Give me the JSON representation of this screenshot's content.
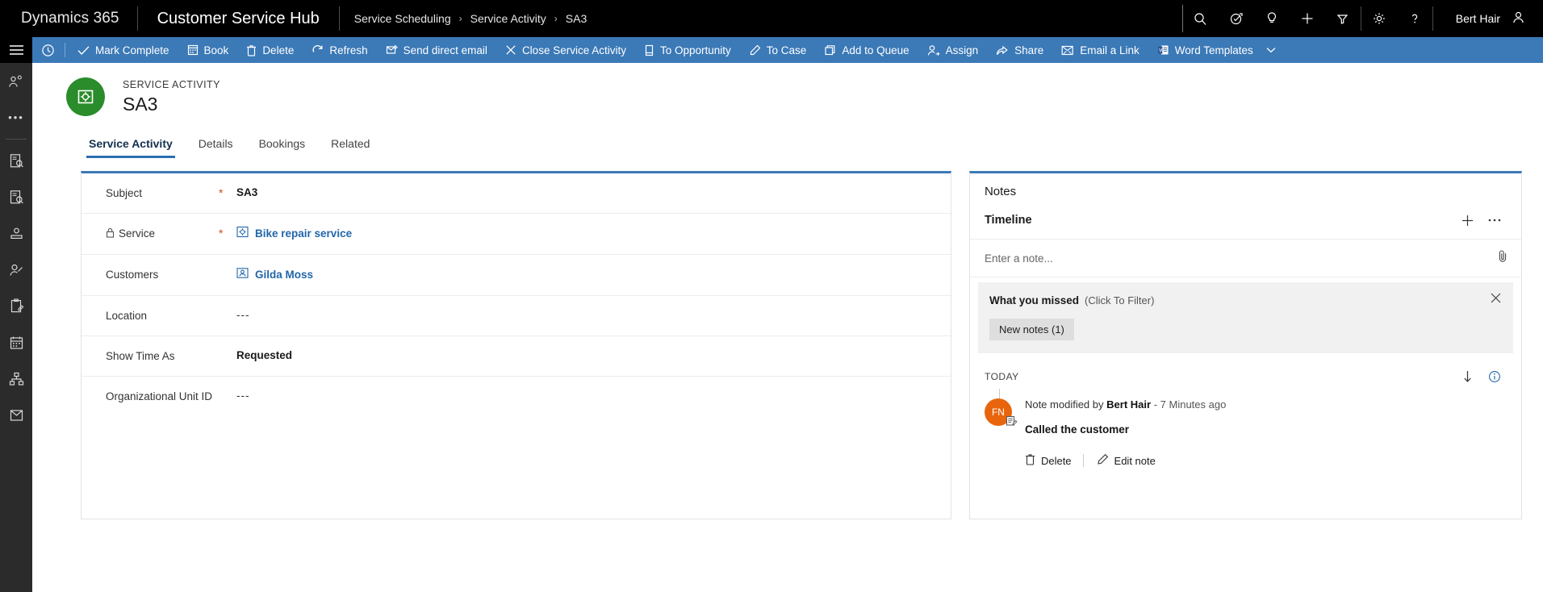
{
  "topnav": {
    "brand": "Dynamics 365",
    "app_title": "Customer Service Hub",
    "breadcrumb": [
      "Service Scheduling",
      "Service Activity",
      "SA3"
    ],
    "chevron": "›",
    "icons": [
      {
        "name": "search-icon",
        "label": "Search"
      },
      {
        "name": "assistant-icon",
        "label": "Assistant"
      },
      {
        "name": "lightbulb-icon",
        "label": "Insights"
      },
      {
        "name": "add-icon",
        "label": "Quick Create"
      },
      {
        "name": "filter-icon",
        "label": "Filter"
      },
      {
        "name": "gear-icon",
        "label": "Settings"
      },
      {
        "name": "help-icon",
        "label": "Help"
      }
    ],
    "user_name": "Bert Hair"
  },
  "rail": {
    "items": [
      {
        "name": "site-map-icon",
        "label": "Site Map"
      },
      {
        "name": "recent-contacts-icon",
        "label": "Recent"
      },
      {
        "name": "more-icon",
        "label": "More"
      },
      {
        "name": "case-icon",
        "label": "Cases"
      },
      {
        "name": "document-search-icon",
        "label": "Knowledge Articles"
      },
      {
        "name": "account-icon",
        "label": "Accounts"
      },
      {
        "name": "contact-icon",
        "label": "Contacts"
      },
      {
        "name": "activity-icon",
        "label": "Activities"
      },
      {
        "name": "calendar-icon",
        "label": "Service Calendar"
      },
      {
        "name": "hierarchy-icon",
        "label": "Hierarchy"
      },
      {
        "name": "queue-icon",
        "label": "Queues"
      }
    ]
  },
  "commandbar": {
    "buttons": [
      {
        "icon": "clock-icon",
        "label": ""
      },
      {
        "icon": "check-icon",
        "label": "Mark Complete"
      },
      {
        "icon": "book-icon",
        "label": "Book"
      },
      {
        "icon": "trash-icon",
        "label": "Delete"
      },
      {
        "icon": "refresh-icon",
        "label": "Refresh"
      },
      {
        "icon": "email-send-icon",
        "label": "Send direct email"
      },
      {
        "icon": "close-icon",
        "label": "Close Service Activity"
      },
      {
        "icon": "opportunity-icon",
        "label": "To Opportunity"
      },
      {
        "icon": "case-convert-icon",
        "label": "To Case"
      },
      {
        "icon": "queue-add-icon",
        "label": "Add to Queue"
      },
      {
        "icon": "assign-icon",
        "label": "Assign"
      },
      {
        "icon": "share-icon",
        "label": "Share"
      },
      {
        "icon": "email-link-icon",
        "label": "Email a Link"
      },
      {
        "icon": "word-icon",
        "label": "Word Templates"
      },
      {
        "icon": "chevron-down-icon",
        "label": ""
      }
    ]
  },
  "record": {
    "kicker": "SERVICE ACTIVITY",
    "title": "SA3",
    "avatar_icon": "service-activity-icon",
    "avatar_color": "#2a8c2a"
  },
  "tabs": [
    {
      "label": "Service Activity",
      "active": true
    },
    {
      "label": "Details",
      "active": false
    },
    {
      "label": "Bookings",
      "active": false
    },
    {
      "label": "Related",
      "active": false
    }
  ],
  "form": {
    "rows": [
      {
        "label": "Subject",
        "required": "*",
        "locked": false,
        "value": "SA3",
        "style": "bold",
        "icon": ""
      },
      {
        "label": "Service",
        "required": "*",
        "locked": true,
        "value": "Bike repair service",
        "style": "link",
        "icon": "service-record-icon"
      },
      {
        "label": "Customers",
        "required": "",
        "locked": false,
        "value": "Gilda Moss",
        "style": "link",
        "icon": "contact-record-icon"
      },
      {
        "label": "Location",
        "required": "",
        "locked": false,
        "value": "---",
        "style": "dash",
        "icon": ""
      },
      {
        "label": "Show Time As",
        "required": "",
        "locked": false,
        "value": "Requested",
        "style": "bold",
        "icon": ""
      },
      {
        "label": "Organizational Unit ID",
        "required": "",
        "locked": false,
        "value": "---",
        "style": "dash",
        "icon": ""
      }
    ]
  },
  "notes": {
    "panel_title": "Notes",
    "timeline_title": "Timeline",
    "add_icon": "add-icon",
    "more_icon": "more-icon",
    "note_placeholder": "Enter a note...",
    "attach_icon": "paperclip-icon",
    "what_you_missed": {
      "title": "What you missed",
      "subtitle": "(Click To Filter)",
      "close_icon": "close-icon",
      "chip": "New notes (1)"
    },
    "today_label": "TODAY",
    "sort_icon": "sort-down-icon",
    "info_icon": "info-icon",
    "entry": {
      "avatar_initials": "FN",
      "avatar_color": "#e8650d",
      "badge_icon": "note-icon",
      "meta_prefix": "Note modified by",
      "meta_author": "Bert Hair",
      "meta_sep": "-",
      "meta_time": "7 Minutes ago",
      "text": "Called the customer",
      "actions": [
        {
          "icon": "trash-icon",
          "label": "Delete"
        },
        {
          "icon": "pencil-icon",
          "label": "Edit note"
        }
      ]
    }
  },
  "colors": {
    "topnav_bg": "#000000",
    "command_bar": "#3b79b7",
    "accent": "#2a6fb1",
    "link": "#2266aa",
    "required": "#d24726",
    "avatar_green": "#2a8c2a",
    "avatar_orange": "#e8650d"
  }
}
